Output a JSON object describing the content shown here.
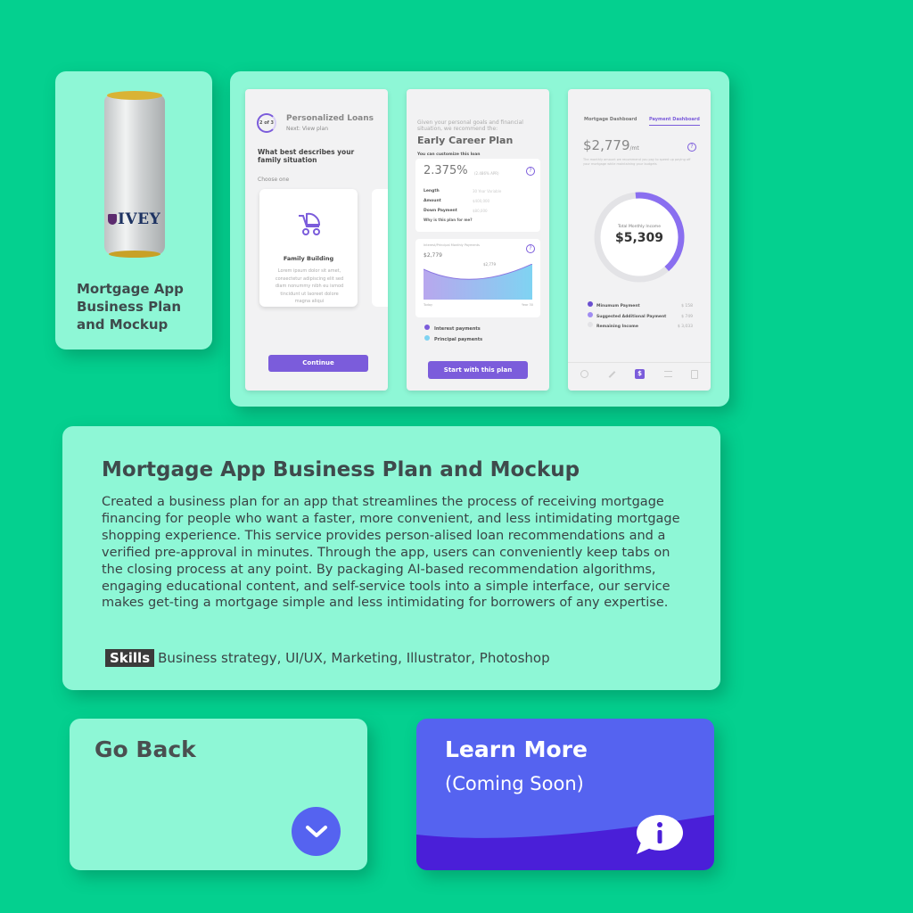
{
  "colors": {
    "background": "#04d08f",
    "card": "#8ef7d6",
    "accent_blue": "#5563f0",
    "accent_purple": "#7b5cdb"
  },
  "project_card": {
    "can_brand": "IVEY",
    "title": "Mortgage App Business Plan and Mockup"
  },
  "mockups": {
    "phone1": {
      "step": "2 of 3",
      "title": "Personalized Loans",
      "subtitle": "Next: View plan",
      "question": "What best describes your family situation",
      "hint": "Choose one",
      "option_title": "Family Building",
      "option_text": "Lorem ipsum dolor sit amet, consectetur adipiscing elit sed diam nonummy nibh eu ismod tincidunt ut laoreet dolore magna aliqui",
      "button": "Continue"
    },
    "phone2": {
      "intro": "Given your personal goals and financial situation, we recommend the:",
      "title": "Early Career Plan",
      "customize": "You can customize this loan",
      "rate": "2.375%",
      "rate_note": "(2.486% APR)",
      "rows": [
        {
          "label": "Length",
          "value": "30 Year Variable"
        },
        {
          "label": "Amount",
          "value": "$400,000"
        },
        {
          "label": "Down Payment",
          "value": "$80,000"
        }
      ],
      "why": "Why is this plan for me?",
      "chart_label": "Interest/Principal Monthly Payments",
      "chart_start": "$2,779",
      "chart_end": "$2,779",
      "axis_start": "Today",
      "axis_end": "Year 30",
      "legend_interest": "Interest payments",
      "legend_principal": "Principal payments",
      "button": "Start with this plan"
    },
    "phone3": {
      "tab1": "Mortgage Dashboard",
      "tab2": "Payment Dashboard",
      "amount": "$2,779",
      "amount_unit": "/mt",
      "note": "The monthly amount we recommend you pay to speed up paying off your mortgage while maintaining your budgets",
      "donut_label": "Total Monthly Income",
      "donut_value": "$5,309",
      "legend": [
        {
          "label": "Minumum Payment",
          "value": "$ 158"
        },
        {
          "label": "Suggested Additional Payment",
          "value": "$ 749"
        },
        {
          "label": "Remaining Income",
          "value": "$ 3,033"
        }
      ]
    }
  },
  "description": {
    "title": "Mortgage App Business Plan and Mockup",
    "body": "Created a business plan for an app that streamlines the process of receiving mortgage financing for people who want a faster, more convenient, and less intimidating mortgage shopping experience. This service provides person-alised loan recommendations and a verified pre-approval in minutes. Through the app, users can conveniently keep tabs on the closing process at any point. By packaging AI-based recommendation algorithms, engaging educational content, and self-service tools into a simple interface, our service makes get-ting a mortgage simple and less intimidating for borrowers of any expertise.",
    "skills_label": "Skills",
    "skills": "Business strategy, UI/UX, Marketing, Illustrator, Photoshop"
  },
  "go_back": {
    "label": "Go Back",
    "icon": "chevron-down-icon"
  },
  "learn_more": {
    "label": "Learn More",
    "sub": "(Coming Soon)",
    "icon": "info-icon"
  }
}
